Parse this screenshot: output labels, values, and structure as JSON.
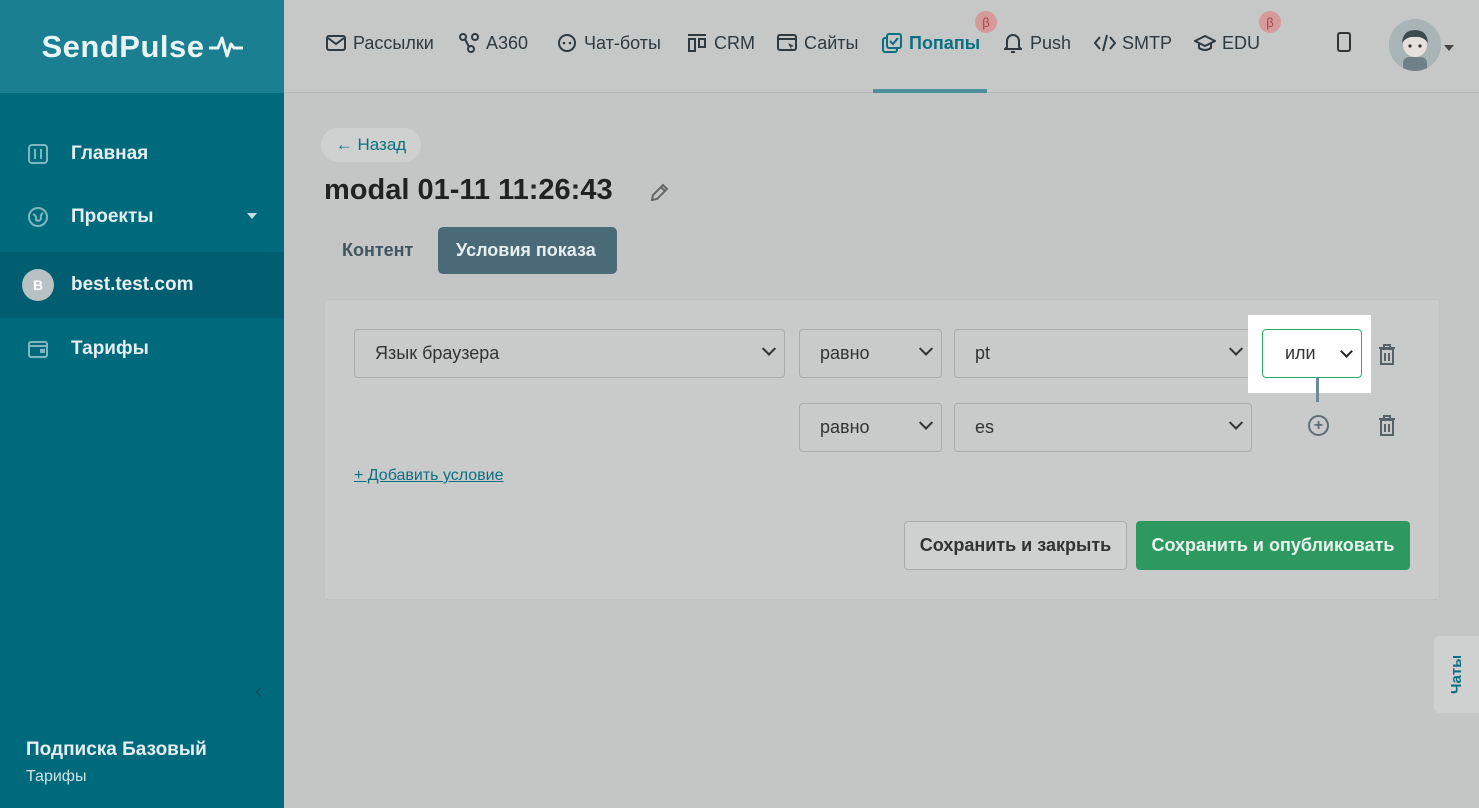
{
  "brand": {
    "name": "SendPulse"
  },
  "sidebar": {
    "items": [
      {
        "label": "Главная",
        "icon": "dashboard-icon"
      },
      {
        "label": "Проекты",
        "icon": "globe-icon"
      },
      {
        "label": "best.test.com",
        "avatar": "B"
      },
      {
        "label": "Тарифы",
        "icon": "wallet-icon"
      }
    ],
    "subscription_title": "Подписка Базовый",
    "subscription_link": "Тарифы"
  },
  "topnav": {
    "items": [
      {
        "label": "Рассылки",
        "icon": "mail-icon"
      },
      {
        "label": "А360",
        "icon": "automation-icon"
      },
      {
        "label": "Чат-боты",
        "icon": "chatbot-icon"
      },
      {
        "label": "CRM",
        "icon": "crm-icon"
      },
      {
        "label": "Сайты",
        "icon": "website-icon"
      },
      {
        "label": "Попапы",
        "icon": "popup-icon",
        "active": true,
        "badge": "β"
      },
      {
        "label": "Push",
        "icon": "bell-icon"
      },
      {
        "label": "SMTP",
        "icon": "code-icon"
      },
      {
        "label": "EDU",
        "icon": "graduation-cap-icon",
        "badge": "β"
      }
    ]
  },
  "main": {
    "back_label": "← Назад",
    "title": "modal 01-11 11:26:43",
    "tabs": [
      {
        "label": "Контент"
      },
      {
        "label": "Условия показа",
        "active": true
      }
    ],
    "condition": {
      "field": "Язык браузера",
      "rows": [
        {
          "operator": "равно",
          "value": "pt",
          "logic": "или"
        },
        {
          "operator": "равно",
          "value": "es"
        }
      ]
    },
    "add_condition_label": "+ Добавить условие",
    "save_close_label": "Сохранить и закрыть",
    "save_publish_label": "Сохранить и опубликовать"
  },
  "chats_label": "Чаты",
  "colors": {
    "sidebar": "#006a7d",
    "accent": "#0b6f80",
    "publish": "#2d9960",
    "beta_badge": "#d69a9a"
  }
}
